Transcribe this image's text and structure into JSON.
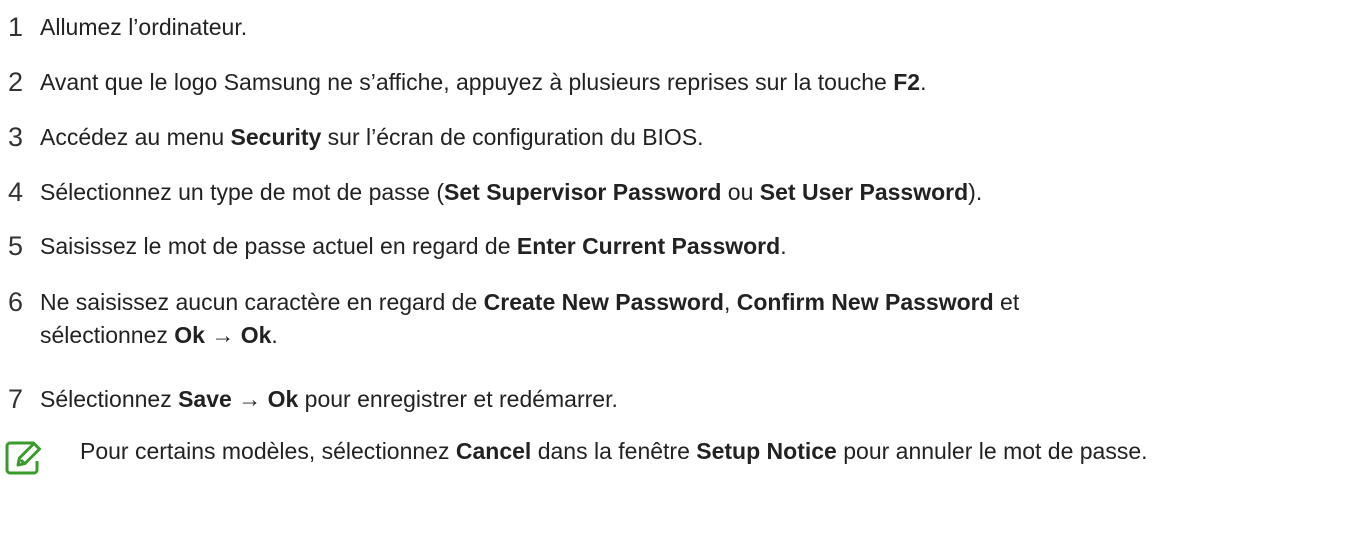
{
  "steps": [
    {
      "num": "1",
      "parts": [
        {
          "t": "Allumez l’ordinateur.",
          "b": false
        }
      ]
    },
    {
      "num": "2",
      "parts": [
        {
          "t": "Avant que le logo Samsung ne s’affiche, appuyez à plusieurs reprises sur la touche ",
          "b": false
        },
        {
          "t": "F2",
          "b": true
        },
        {
          "t": ".",
          "b": false
        }
      ]
    },
    {
      "num": "3",
      "parts": [
        {
          "t": "Accédez au menu ",
          "b": false
        },
        {
          "t": "Security",
          "b": true
        },
        {
          "t": " sur l’écran de configuration du BIOS.",
          "b": false
        }
      ]
    },
    {
      "num": "4",
      "parts": [
        {
          "t": "Sélectionnez un type de mot de passe (",
          "b": false
        },
        {
          "t": "Set Supervisor Password",
          "b": true
        },
        {
          "t": " ou ",
          "b": false
        },
        {
          "t": "Set User Password",
          "b": true
        },
        {
          "t": ").",
          "b": false
        }
      ]
    },
    {
      "num": "5",
      "parts": [
        {
          "t": "Saisissez le mot de passe actuel en regard de ",
          "b": false
        },
        {
          "t": "Enter Current Password",
          "b": true
        },
        {
          "t": ".",
          "b": false
        }
      ]
    },
    {
      "num": "6",
      "parts": [
        {
          "t": "Ne saisissez aucun caractère en regard de ",
          "b": false
        },
        {
          "t": "Create New Password",
          "b": true
        },
        {
          "t": ", ",
          "b": false
        },
        {
          "t": "Confirm New Password",
          "b": true
        },
        {
          "t": " et sélectionnez ",
          "b": false
        },
        {
          "t": "Ok",
          "b": true
        },
        {
          "t": " → ",
          "b": false
        },
        {
          "t": "Ok",
          "b": true
        },
        {
          "t": ".",
          "b": false
        }
      ]
    },
    {
      "num": "7",
      "parts": [
        {
          "t": "Sélectionnez ",
          "b": false
        },
        {
          "t": "Save",
          "b": true
        },
        {
          "t": " → ",
          "b": false
        },
        {
          "t": "Ok",
          "b": true
        },
        {
          "t": " pour enregistrer et redémarrer.",
          "b": false
        }
      ]
    }
  ],
  "note": {
    "icon": "note-pencil-icon",
    "icon_color": "#3a9a2c",
    "parts": [
      {
        "t": "Pour certains modèles, sélectionnez ",
        "b": false
      },
      {
        "t": "Cancel",
        "b": true
      },
      {
        "t": " dans la fenêtre ",
        "b": false
      },
      {
        "t": "Setup Notice",
        "b": true
      },
      {
        "t": " pour annuler le mot de passe.",
        "b": false
      }
    ]
  }
}
